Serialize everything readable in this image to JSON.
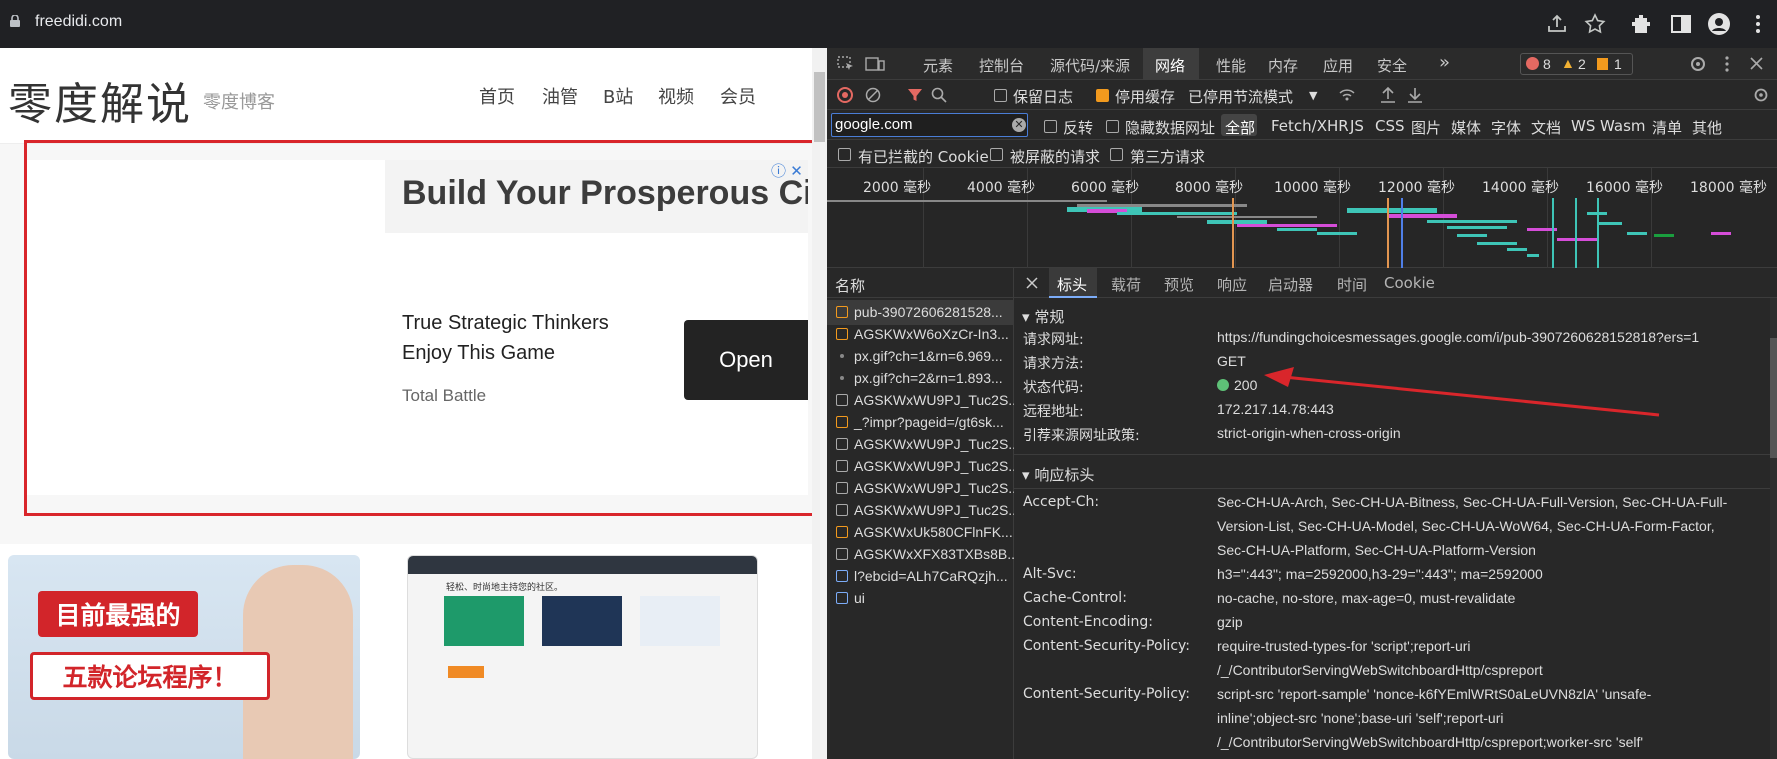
{
  "browser": {
    "url": "freedidi.com"
  },
  "site": {
    "logo": "零度解说",
    "subtitle": "零度博客",
    "nav": [
      "首页",
      "油管",
      "B站",
      "视频",
      "会员"
    ]
  },
  "ad": {
    "title": "Build Your Prosperous Ci",
    "line1": "True Strategic Thinkers",
    "line2": "Enjoy This Game",
    "brand": "Total Battle",
    "open_label": "Open",
    "info_icon": "ⓘ",
    "close_icon": "✕"
  },
  "thumbs": {
    "t1_badge": "目前最强的",
    "t1_badge2": "五款论坛程序！",
    "t2_title": "轻松、时尚地主持您的社区。"
  },
  "devtools": {
    "tabs": [
      "元素",
      "控制台",
      "源代码/来源",
      "网络",
      "性能",
      "内存",
      "应用",
      "安全"
    ],
    "active_tab": "网络",
    "more_tabs": "»",
    "errors": "8",
    "warnings": "2",
    "infos": "1",
    "toolbar": {
      "preserve_log": "保留日志",
      "disable_cache": "停用缓存",
      "throttle": "已停用节流模式"
    },
    "filter": {
      "value": "google.com",
      "invert": "反转",
      "hide_data_urls": "隐藏数据网址",
      "types": [
        "全部",
        "Fetch/XHR",
        "JS",
        "CSS",
        "图片",
        "媒体",
        "字体",
        "文档",
        "WS",
        "Wasm",
        "清单",
        "其他"
      ],
      "blocked_cookies": "有已拦截的 Cookie",
      "blocked_requests": "被屏蔽的请求",
      "third_party": "第三方请求"
    },
    "timeline_labels": [
      "2000 毫秒",
      "4000 毫秒",
      "6000 毫秒",
      "8000 毫秒",
      "10000 毫秒",
      "12000 毫秒",
      "14000 毫秒",
      "16000 毫秒",
      "18000 毫秒"
    ],
    "names_header": "名称",
    "requests": [
      {
        "name": "pub-39072606281528...",
        "type": "script"
      },
      {
        "name": "AGSKWxW6oXzCr-In3...",
        "type": "script"
      },
      {
        "name": "px.gif?ch=1&rn=6.969...",
        "type": "img"
      },
      {
        "name": "px.gif?ch=2&rn=1.893...",
        "type": "img"
      },
      {
        "name": "AGSKWxWU9PJ_Tuc2S...",
        "type": "other"
      },
      {
        "name": "_?impr?pageid=/gt6sk...",
        "type": "script"
      },
      {
        "name": "AGSKWxWU9PJ_Tuc2S...",
        "type": "other"
      },
      {
        "name": "AGSKWxWU9PJ_Tuc2S...",
        "type": "other"
      },
      {
        "name": "AGSKWxWU9PJ_Tuc2S...",
        "type": "other"
      },
      {
        "name": "AGSKWxWU9PJ_Tuc2S...",
        "type": "other"
      },
      {
        "name": "AGSKWxUk580CFlnFK...",
        "type": "script"
      },
      {
        "name": "AGSKWxXFX83TXBs8B...",
        "type": "other"
      },
      {
        "name": "l?ebcid=ALh7CaRQzjh...",
        "type": "doc"
      },
      {
        "name": "ui",
        "type": "doc"
      }
    ],
    "detail_tabs": [
      "标头",
      "载荷",
      "预览",
      "响应",
      "启动器",
      "时间",
      "Cookie"
    ],
    "active_detail_tab": "标头",
    "general_title": "常规",
    "general": [
      {
        "k": "请求网址:",
        "v": "https://fundingchoicesmessages.google.com/i/pub-3907260628152818?ers=1"
      },
      {
        "k": "请求方法:",
        "v": "GET"
      },
      {
        "k": "状态代码:",
        "v": "200"
      },
      {
        "k": "远程地址:",
        "v": "172.217.14.78:443"
      },
      {
        "k": "引荐来源网址政策:",
        "v": "strict-origin-when-cross-origin"
      }
    ],
    "response_title": "响应标头",
    "response": {
      "accept_ch_k": "Accept-Ch:",
      "accept_ch_v1": "Sec-CH-UA-Arch, Sec-CH-UA-Bitness, Sec-CH-UA-Full-Version, Sec-CH-UA-Full-",
      "accept_ch_v2": "Version-List, Sec-CH-UA-Model, Sec-CH-UA-WoW64, Sec-CH-UA-Form-Factor,",
      "accept_ch_v3": "Sec-CH-UA-Platform, Sec-CH-UA-Platform-Version",
      "alt_svc_k": "Alt-Svc:",
      "alt_svc_v": "h3=\":443\"; ma=2592000,h3-29=\":443\"; ma=2592000",
      "cache_k": "Cache-Control:",
      "cache_v": "no-cache, no-store, max-age=0, must-revalidate",
      "enc_k": "Content-Encoding:",
      "enc_v": "gzip",
      "csp1_k": "Content-Security-Policy:",
      "csp1_v1": "require-trusted-types-for 'script';report-uri",
      "csp1_v2": "/_/ContributorServingWebSwitchboardHttp/cspreport",
      "csp2_k": "Content-Security-Policy:",
      "csp2_v1": "script-src 'report-sample' 'nonce-k6fYEmlWRtS0aLeUVN8zlA' 'unsafe-",
      "csp2_v2": "inline';object-src 'none';base-uri 'self';report-uri",
      "csp2_v3": "/_/ContributorServingWebSwitchboardHttp/cspreport;worker-src 'self'"
    }
  },
  "colors": {
    "annotation_red": "#d9262b",
    "status_green": "#5ec177",
    "accent_blue": "#7cacf8"
  }
}
